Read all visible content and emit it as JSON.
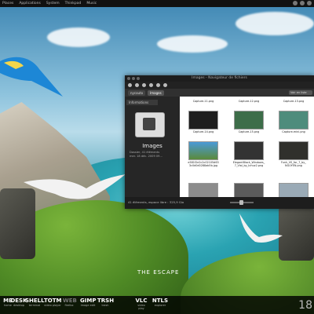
{
  "topbar": {
    "menus": [
      "Places",
      "Applications",
      "System",
      "Thinkpad",
      "Music"
    ]
  },
  "wallpaper": {
    "caption": "THE ESCAPE"
  },
  "window": {
    "title": "Images - Navigateur de fichiers",
    "breadcrumbs": [
      "nycouto",
      "Images"
    ],
    "search_placeholder": "Voir en liste",
    "sidebar_header": "Informations",
    "folder_name": "Images",
    "folder_meta": [
      "Dossier, 41 éléments",
      "mer. 18 déc. 2009 09..."
    ],
    "files": [
      {
        "name": "Capture-11.png",
        "color": "#1e1e1e"
      },
      {
        "name": "Capture-12.png",
        "color": "#2d3a2a"
      },
      {
        "name": "Capture-13.png",
        "color": "#6aa7a0"
      },
      {
        "name": "Capture-14.png",
        "color": "#222222"
      },
      {
        "name": "Capture-15.png",
        "color": "#3d6d49"
      },
      {
        "name": "Capture-mini.png",
        "color": "#4e8c7c"
      },
      {
        "name": "e381f2e2c2c02105d63 3c0d0d0288ab5b.jpg",
        "color": "#5a8a3a"
      },
      {
        "name": "ElegantBlack_Windows_ 7_Vial_by_tchuz2.png",
        "color": "#333333"
      },
      {
        "name": "Funk_VS_for_7_by_ NGUYEN.png",
        "color": "#30302c"
      }
    ],
    "status": "41 éléments, espace libre : 325,9 Gio"
  },
  "dock": {
    "items": [
      {
        "title": "ME",
        "sub": "home"
      },
      {
        "title": "DESK",
        "sub": "desktop"
      },
      {
        "title": "SHELL",
        "sub": "terminal"
      },
      {
        "title": "TOTM",
        "sub": "video player"
      },
      {
        "title": "WEB",
        "sub": "firefox"
      },
      {
        "title": "GIMP",
        "sub": "image edit"
      },
      {
        "title": "TRSH",
        "sub": "trash"
      },
      {
        "title": "VLC",
        "sub": "video play"
      },
      {
        "title": "NTLS",
        "sub": "explorer"
      }
    ],
    "clock": "18"
  }
}
